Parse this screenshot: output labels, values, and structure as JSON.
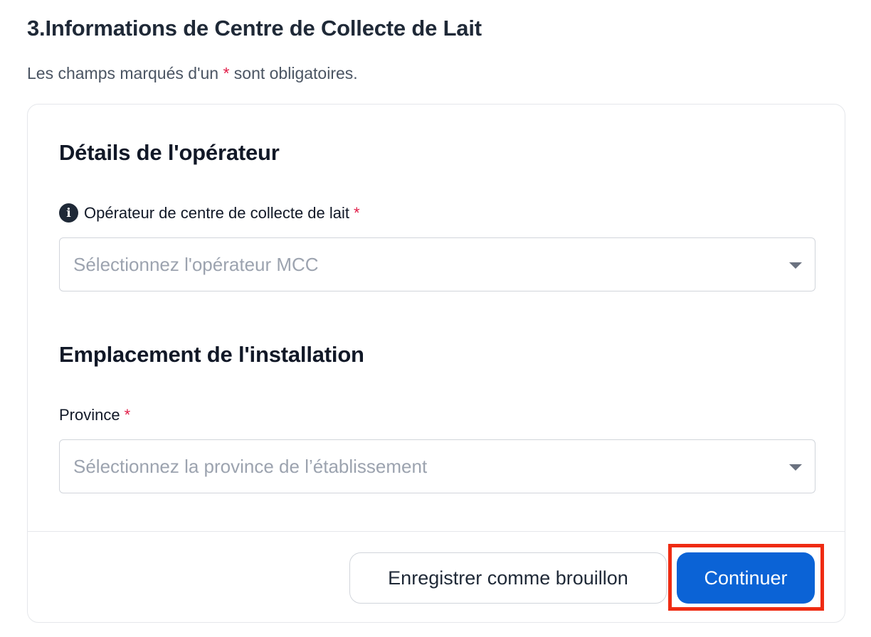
{
  "header": {
    "title": "3.Informations de Centre de Collecte de Lait",
    "subtitle_before": "Les champs marqués d'un",
    "subtitle_star": "*",
    "subtitle_after": "sont obligatoires."
  },
  "operator_section": {
    "title": "Détails de l'opérateur",
    "field_label": "Opérateur de centre de collecte de lait",
    "required_mark": "*",
    "info_icon_glyph": "i",
    "select_placeholder": "Sélectionnez l'opérateur MCC"
  },
  "location_section": {
    "title": "Emplacement de l'installation",
    "field_label": "Province",
    "required_mark": "*",
    "select_placeholder": "Sélectionnez la province de l’établissement"
  },
  "footer": {
    "draft_button": "Enregistrer comme brouillon",
    "continue_button": "Continuer"
  },
  "colors": {
    "primary": "#0b63d6",
    "required": "#e11d48",
    "highlight": "#ef2b12"
  },
  "icons": {
    "info": "info-circle-icon",
    "dropdown": "caret-down-icon"
  }
}
